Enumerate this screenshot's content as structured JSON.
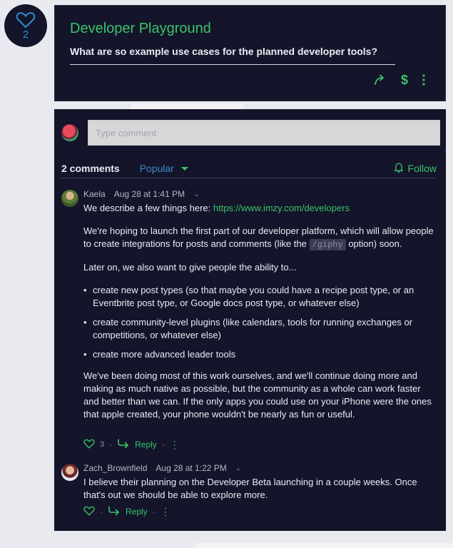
{
  "like": {
    "count": "2",
    "icon": "heart-outline-icon"
  },
  "post": {
    "title": "Developer Playground",
    "question": "What are so example use cases for the planned developer tools?",
    "actions": {
      "share_icon": "share-arrow-icon",
      "tip_icon": "dollar-icon",
      "more_icon": "kebab-icon"
    }
  },
  "comment_box": {
    "placeholder": "Type comment"
  },
  "comments_header": {
    "count": "2 comments",
    "sort": "Popular",
    "follow": "Follow"
  },
  "comments": [
    {
      "author": "Kaela",
      "timestamp": "Aug 28 at 1:41 PM",
      "intro": "We describe a few things here: ",
      "link": "https://www.imzy.com/developers",
      "p2_pre": "We're hoping to launch the first part of our developer platform, which will allow people to create integrations for posts and comments (like the ",
      "p2_code": "/giphy",
      "p2_post": " option) soon.",
      "p3": "Later on, we also want to give people the ability to...",
      "bullets": [
        "create new post types (so that maybe you could have a recipe post type, or an Eventbrite post type, or Google docs post type, or whatever else)",
        "create community-level plugins (like calendars, tools for running exchanges or competitions, or whatever else)",
        "create more advanced leader tools"
      ],
      "p4": "We've been doing most of this work ourselves, and we'll continue doing more and making as much native as possible, but the community as a whole can work faster and better than we can. If the only apps you could use on your iPhone were the ones that apple created, your phone wouldn't be nearly as fun or useful.",
      "likes": "3",
      "reply": "Reply"
    },
    {
      "author": "Zach_Brownfield",
      "timestamp": "Aug 28 at 1:22 PM",
      "body": "I believe their planning on the Developer Beta launching in a couple weeks. Once that's out we should be able to explore more.",
      "reply": "Reply"
    }
  ]
}
